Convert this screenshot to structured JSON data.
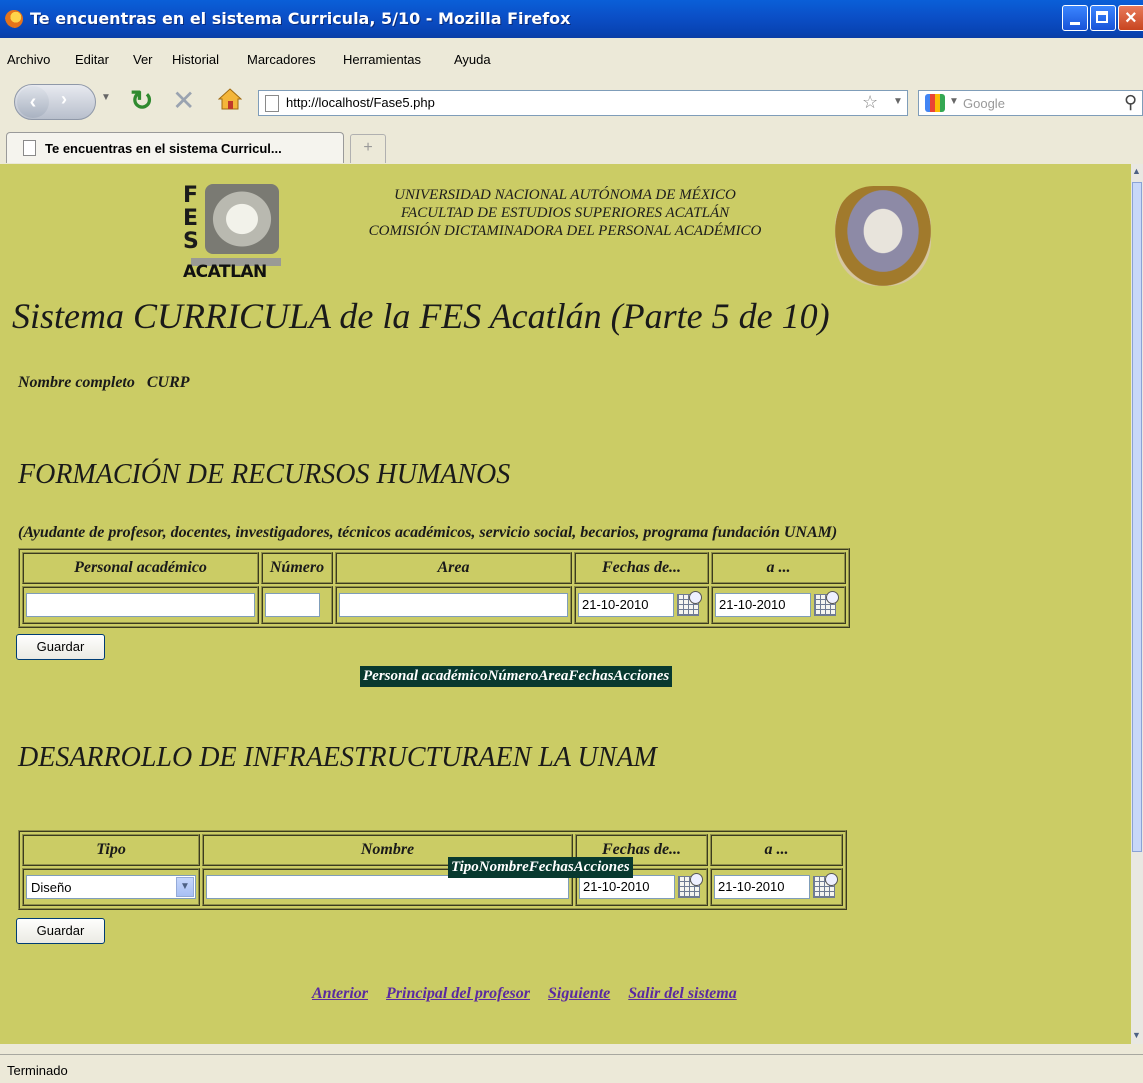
{
  "window": {
    "title": "Te encuentras en el sistema Curricula, 5/10 - Mozilla Firefox"
  },
  "menu": [
    "Archivo",
    "Editar",
    "Ver",
    "Historial",
    "Marcadores",
    "Herramientas",
    "Ayuda"
  ],
  "toolbar": {
    "url": "http://localhost/Fase5.php",
    "search_placeholder": "Google"
  },
  "tab": {
    "label": "Te encuentras en el sistema Curricul...",
    "new_tab": "+"
  },
  "header": {
    "logo_text": "ACATLAN",
    "logo_letters": [
      "F",
      "E",
      "S"
    ],
    "lines": [
      "UNIVERSIDAD NACIONAL AUTÓNOMA DE MÉXICO",
      "FACULTAD DE ESTUDIOS SUPERIORES ACATLÁN",
      "COMISIÓN DICTAMINADORA DEL PERSONAL ACADÉMICO"
    ]
  },
  "page_title": "Sistema CURRICULA de la FES Acatlán (Parte 5 de 10)",
  "person": {
    "nombre": "Nombre completo",
    "curp": "CURP"
  },
  "section1": {
    "title": "FORMACIÓN DE RECURSOS HUMANOS",
    "subtitle": "(Ayudante de profesor, docentes, investigadores, técnicos académicos, servicio social, becarios, programa fundación UNAM)",
    "headers": [
      "Personal académico",
      "Número",
      "Area",
      "Fechas de...",
      "a ..."
    ],
    "date_from": "21-10-2010",
    "date_to": "21-10-2010",
    "save_label": "Guardar",
    "results_header": "Personal académicoNúmeroAreaFechasAcciones"
  },
  "section2": {
    "title": "DESARROLLO DE INFRAESTRUCTURAEN LA UNAM",
    "headers": [
      "Tipo",
      "Nombre",
      "Fechas de...",
      "a ..."
    ],
    "tipo_value": "Diseño",
    "date_from": "21-10-2010",
    "date_to": "21-10-2010",
    "save_label": "Guardar",
    "results_header": "TipoNombreFechasAcciones"
  },
  "footer_links": [
    "Anterior",
    "Principal del profesor",
    "Siguiente",
    "Salir del sistema"
  ],
  "status": "Terminado"
}
